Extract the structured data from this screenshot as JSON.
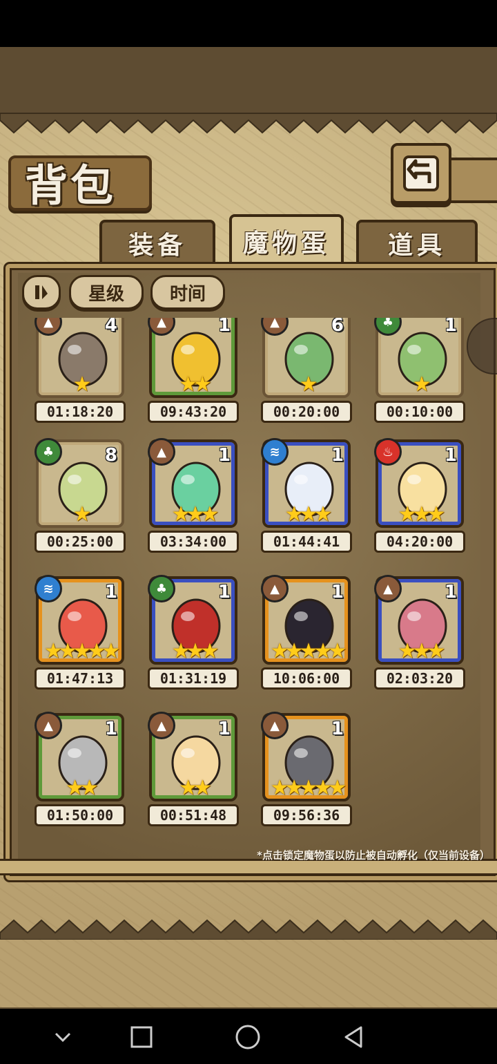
{
  "screen": {
    "title": "背包"
  },
  "tabs": [
    {
      "label": "装备",
      "active": false
    },
    {
      "label": "魔物蛋",
      "active": true
    },
    {
      "label": "道具",
      "active": false
    }
  ],
  "sort": {
    "stop_icon": "pause-sort-icon",
    "star_label": "星级",
    "time_label": "时间"
  },
  "eggs": [
    {
      "element": "earth",
      "count": "4",
      "stars": 1,
      "rarity": "brown",
      "timer": "01:18:20"
    },
    {
      "element": "earth",
      "count": "1",
      "stars": 2,
      "rarity": "green",
      "timer": "09:43:20"
    },
    {
      "element": "earth",
      "count": "6",
      "stars": 1,
      "rarity": "brown",
      "timer": "00:20:00"
    },
    {
      "element": "leaf",
      "count": "1",
      "stars": 1,
      "rarity": "brown",
      "timer": "00:10:00"
    },
    {
      "element": "leaf",
      "count": "8",
      "stars": 1,
      "rarity": "brown",
      "timer": "00:25:00"
    },
    {
      "element": "earth",
      "count": "1",
      "stars": 3,
      "rarity": "blue",
      "timer": "03:34:00"
    },
    {
      "element": "water",
      "count": "1",
      "stars": 3,
      "rarity": "blue",
      "timer": "01:44:41"
    },
    {
      "element": "fire",
      "count": "1",
      "stars": 3,
      "rarity": "blue",
      "timer": "04:20:00"
    },
    {
      "element": "water",
      "count": "1",
      "stars": 5,
      "rarity": "orange",
      "timer": "01:47:13"
    },
    {
      "element": "leaf",
      "count": "1",
      "stars": 3,
      "rarity": "blue",
      "timer": "01:31:19"
    },
    {
      "element": "earth",
      "count": "1",
      "stars": 5,
      "rarity": "orange",
      "timer": "10:06:00"
    },
    {
      "element": "earth",
      "count": "1",
      "stars": 3,
      "rarity": "blue",
      "timer": "02:03:20"
    },
    {
      "element": "earth",
      "count": "1",
      "stars": 2,
      "rarity": "green",
      "timer": "01:50:00"
    },
    {
      "element": "earth",
      "count": "1",
      "stars": 2,
      "rarity": "green",
      "timer": "00:51:48"
    },
    {
      "element": "earth",
      "count": "1",
      "stars": 5,
      "rarity": "orange",
      "timer": "09:56:36"
    }
  ],
  "hint": "*点击锁定魔物蛋以防止被自动孵化（仅当前设备）",
  "colors": {
    "earth": "#8a5a3a",
    "leaf": "#3f8a3a",
    "water": "#2f7fd0",
    "fire": "#d8322a"
  },
  "nav": {
    "back_icon": "nav-back-icon",
    "home_icon": "nav-home-icon",
    "recents_icon": "nav-recents-icon",
    "collapse_icon": "nav-collapse-icon"
  }
}
